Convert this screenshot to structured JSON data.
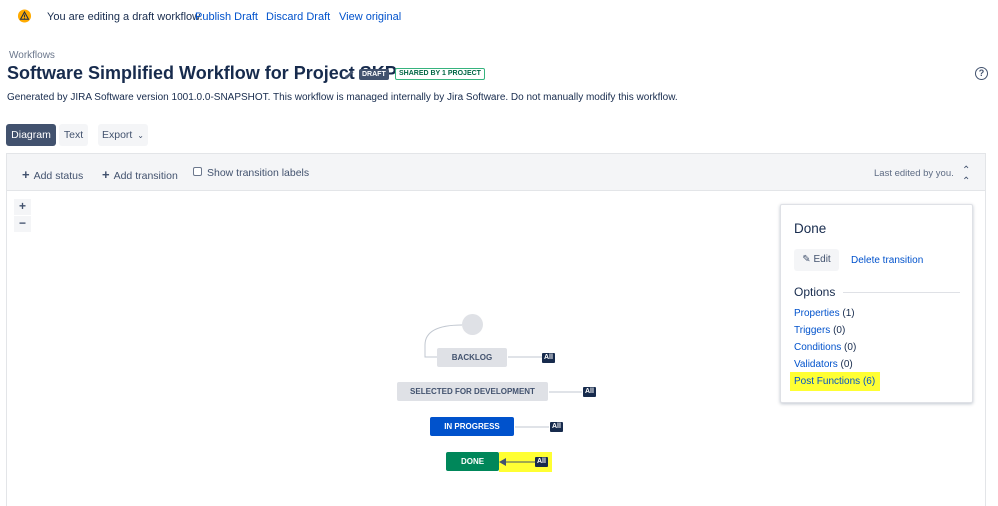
{
  "banner": {
    "message": "You are editing a draft workflow.",
    "publish_label": "Publish Draft",
    "discard_label": "Discard Draft",
    "view_label": "View original"
  },
  "header": {
    "breadcrumb": "Workflows",
    "title": "Software Simplified Workflow for Project SKP",
    "draft_badge": "DRAFT",
    "shared_badge": "SHARED BY 1 PROJECT",
    "help": "?",
    "description": "Generated by JIRA Software version 1001.0.0-SNAPSHOT. This workflow is managed internally by Jira Software. Do not manually modify this workflow."
  },
  "view_tabs": {
    "diagram": "Diagram",
    "text": "Text",
    "export": "Export",
    "active": "Diagram"
  },
  "toolbar": {
    "add_status": "Add status",
    "add_transition": "Add transition",
    "show_labels": "Show transition labels",
    "show_labels_checked": false,
    "last_edited": "Last edited by you."
  },
  "zoom": {
    "in": "+",
    "out": "−"
  },
  "diagram": {
    "statuses": [
      {
        "name": "BACKLOG",
        "category": "todo"
      },
      {
        "name": "SELECTED FOR DEVELOPMENT",
        "category": "todo"
      },
      {
        "name": "IN PROGRESS",
        "category": "inprogress"
      },
      {
        "name": "DONE",
        "category": "done"
      }
    ],
    "all_label": "All"
  },
  "panel": {
    "title": "Done",
    "edit_label": "Edit",
    "delete_label": "Delete transition",
    "options_heading": "Options",
    "options": [
      {
        "label": "Properties",
        "count": "(1)"
      },
      {
        "label": "Triggers",
        "count": "(0)"
      },
      {
        "label": "Conditions",
        "count": "(0)"
      },
      {
        "label": "Validators",
        "count": "(0)"
      },
      {
        "label": "Post Functions",
        "count": "(6)"
      }
    ]
  },
  "colors": {
    "link": "#0052cc",
    "todo": "#dfe1e6",
    "inprogress": "#0052cc",
    "done": "#00875a",
    "highlight": "#ffff33"
  }
}
